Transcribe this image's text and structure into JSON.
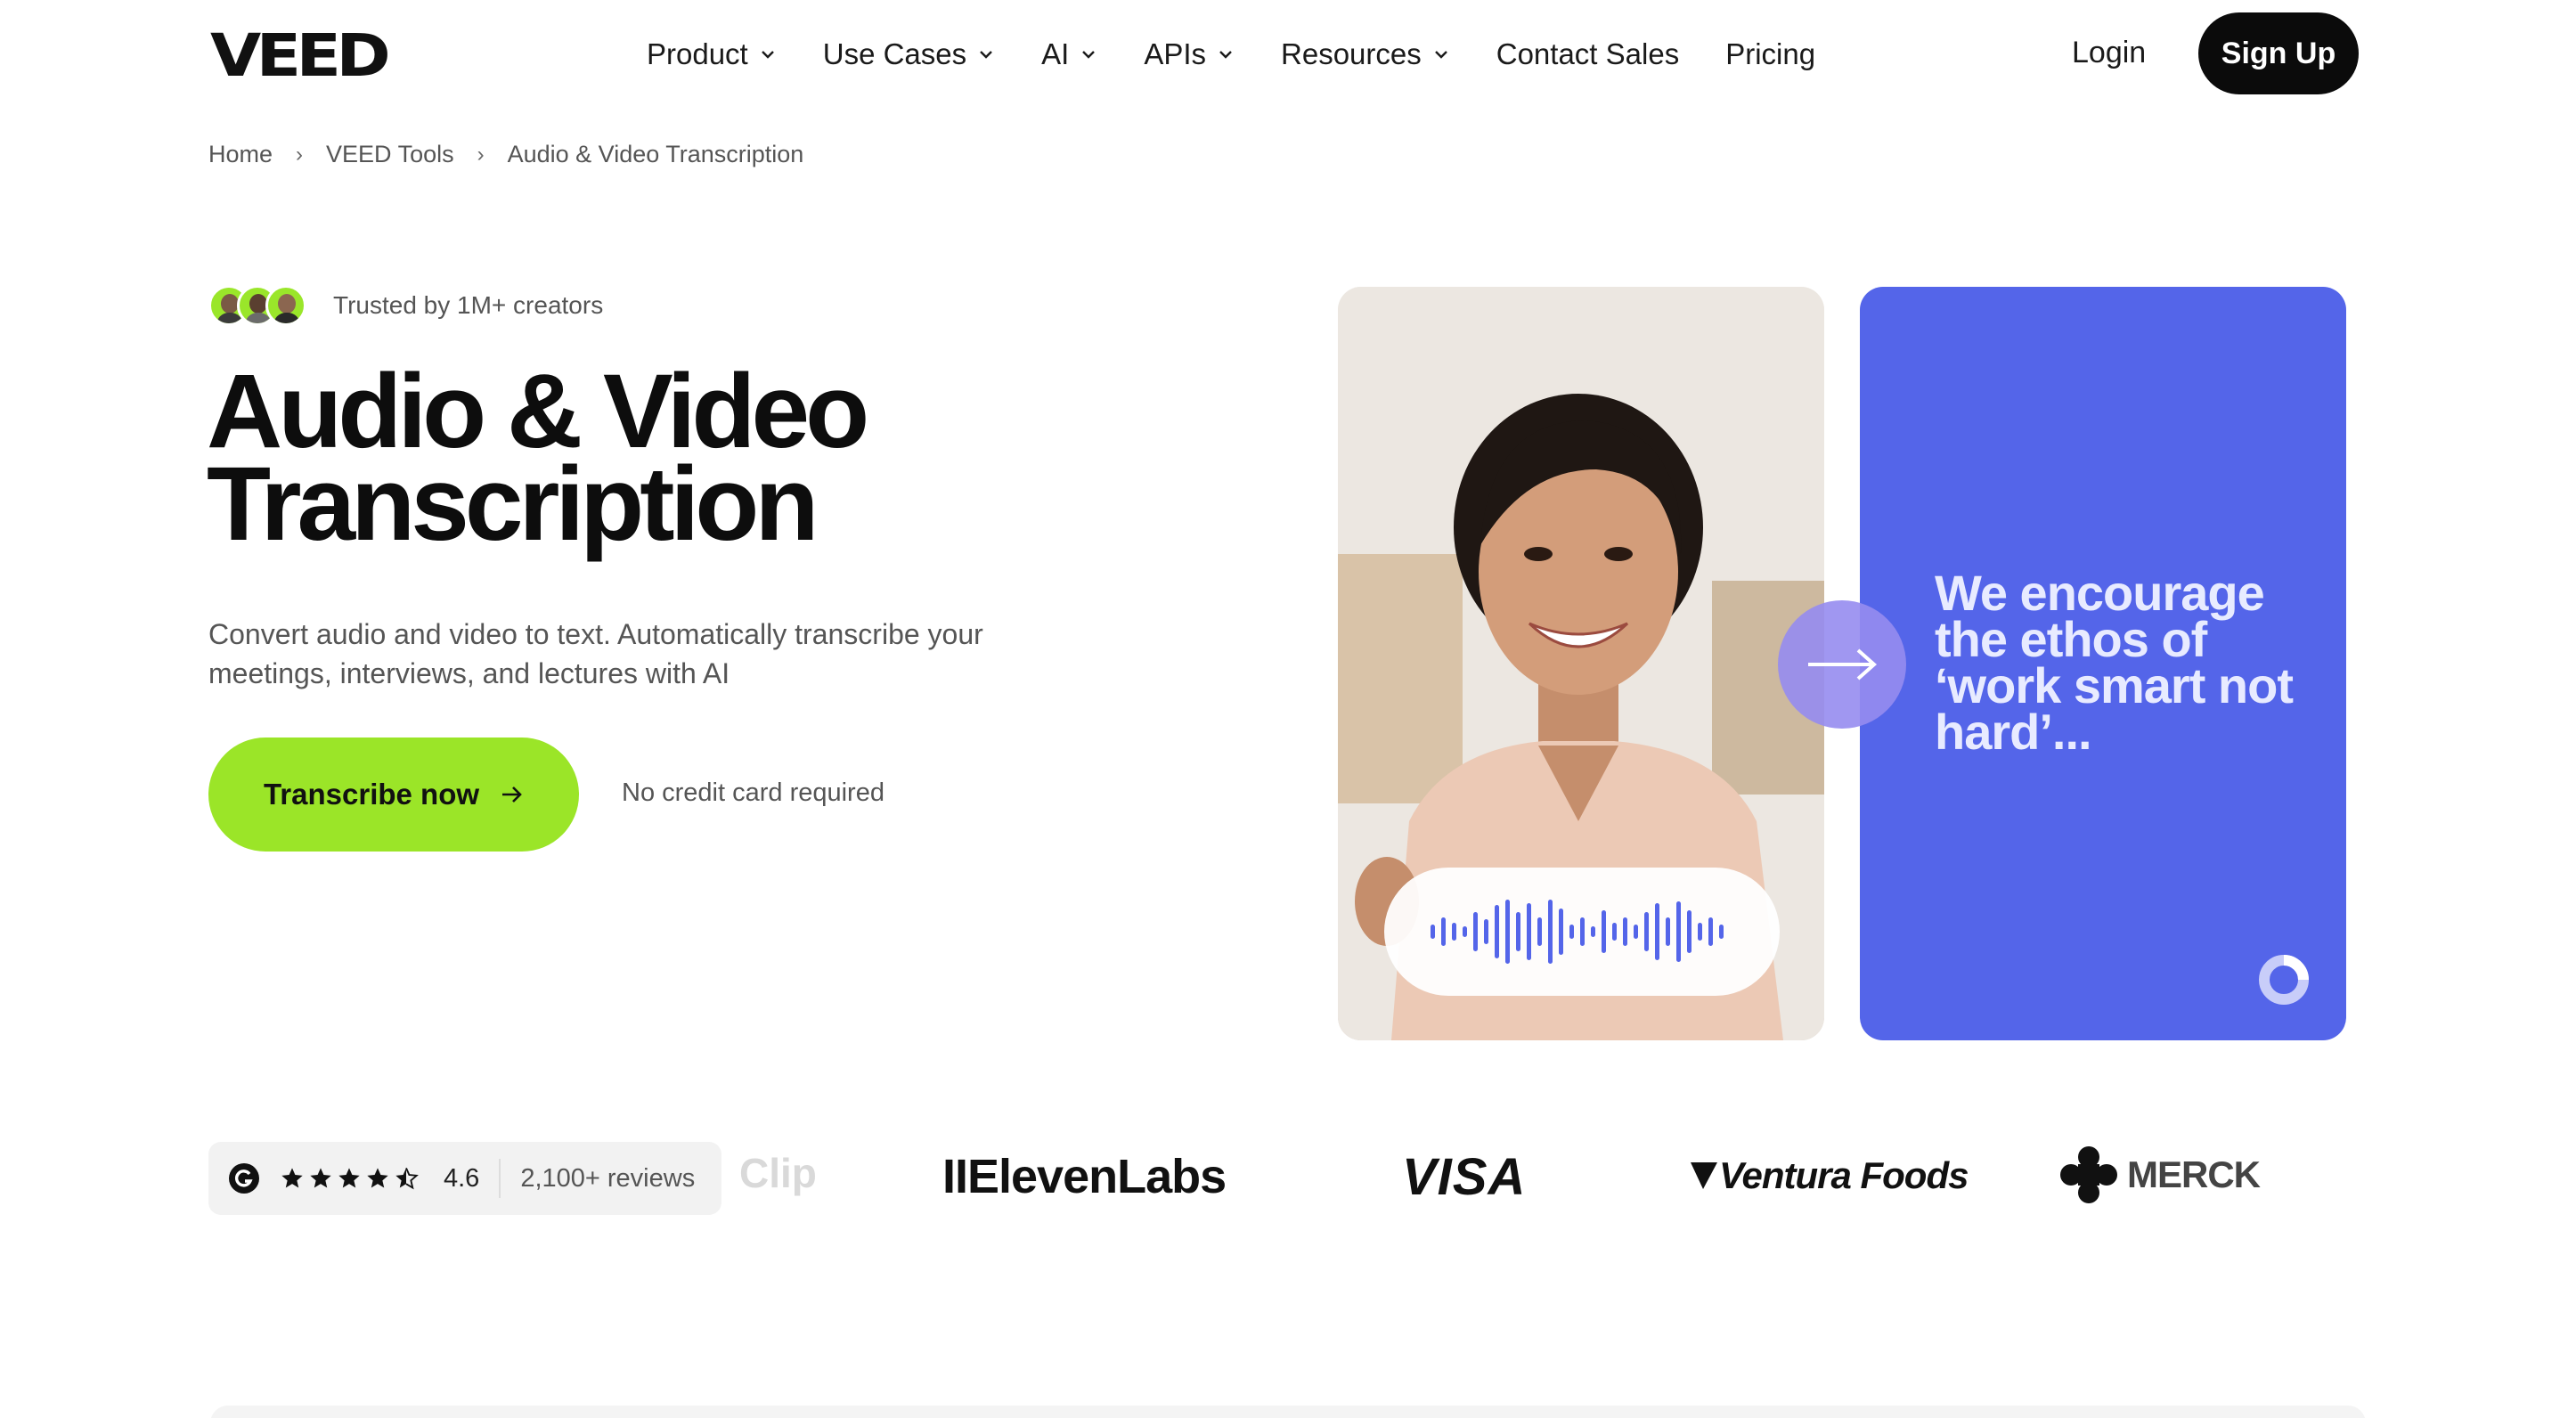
{
  "header": {
    "logo": "VEED",
    "nav": [
      {
        "label": "Product",
        "dropdown": true
      },
      {
        "label": "Use Cases",
        "dropdown": true
      },
      {
        "label": "AI",
        "dropdown": true
      },
      {
        "label": "APIs",
        "dropdown": true
      },
      {
        "label": "Resources",
        "dropdown": true
      },
      {
        "label": "Contact Sales",
        "dropdown": false
      },
      {
        "label": "Pricing",
        "dropdown": false
      }
    ],
    "login": "Login",
    "signup": "Sign Up"
  },
  "breadcrumb": [
    "Home",
    "VEED Tools",
    "Audio & Video Transcription"
  ],
  "trust": {
    "text": "Trusted by 1M+ creators"
  },
  "hero": {
    "title_line1": "Audio & Video",
    "title_line2": "Transcription",
    "subtitle": "Convert audio and video to text. Automatically transcribe your meetings, interviews, and lectures with AI",
    "cta": "Transcribe now",
    "no_card": "No credit card required"
  },
  "media": {
    "quote": "We encourage the ethos of ‘work smart not hard’..."
  },
  "reviews": {
    "rating": "4.6",
    "stars": 4.5,
    "count": "2,100+ reviews"
  },
  "logos": {
    "clip": "Clip",
    "elevenlabs": "IIElevenLabs",
    "visa": "VISA",
    "ventura": "Ventura Foods",
    "merck": "MERCK"
  },
  "colors": {
    "accent_green": "#9be528",
    "card_blue": "#5465e9",
    "dark": "#0b0b0b"
  }
}
